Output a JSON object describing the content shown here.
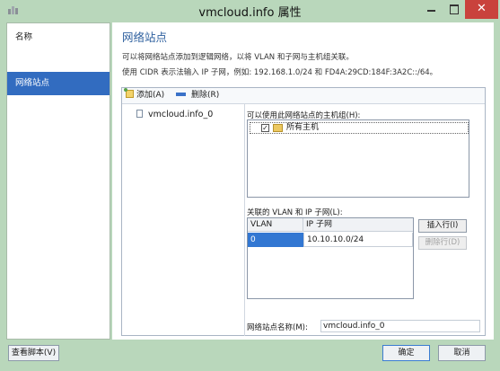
{
  "window": {
    "title": "vmcloud.info 属性",
    "close_glyph": "✕"
  },
  "nav": {
    "items": [
      {
        "label": "名称"
      },
      {
        "label": "网络站点"
      }
    ]
  },
  "content": {
    "title": "网络站点",
    "desc1": "可以将网络站点添加到逻辑网络，以将 VLAN 和子网与主机组关联。",
    "desc2": "使用 CIDR 表示法输入 IP 子网，例如: 192.168.1.0/24 和 FD4A:29CD:184F:3A2C::/64。"
  },
  "toolbar": {
    "add_label": "添加(A)",
    "delete_label": "删除(R)"
  },
  "sites": [
    {
      "name": "vmcloud.info_0"
    }
  ],
  "hostgroups": {
    "label": "可以使用此网络站点的主机组(H):",
    "items": [
      {
        "name": "所有主机",
        "checked": "✓"
      }
    ]
  },
  "vlan": {
    "label": "关联的 VLAN 和 IP 子网(L):",
    "columns": [
      "VLAN",
      "IP 子网"
    ],
    "rows": [
      {
        "vlan": "0",
        "subnet": "10.10.10.0/24"
      }
    ],
    "insert_label": "插入行(I)",
    "delete_row_label": "删除行(D)"
  },
  "site_name": {
    "label": "网络站点名称(M):",
    "value": "vmcloud.info_0"
  },
  "footer": {
    "script_label": "查看脚本(V)",
    "ok_label": "确定",
    "cancel_label": "取消"
  }
}
